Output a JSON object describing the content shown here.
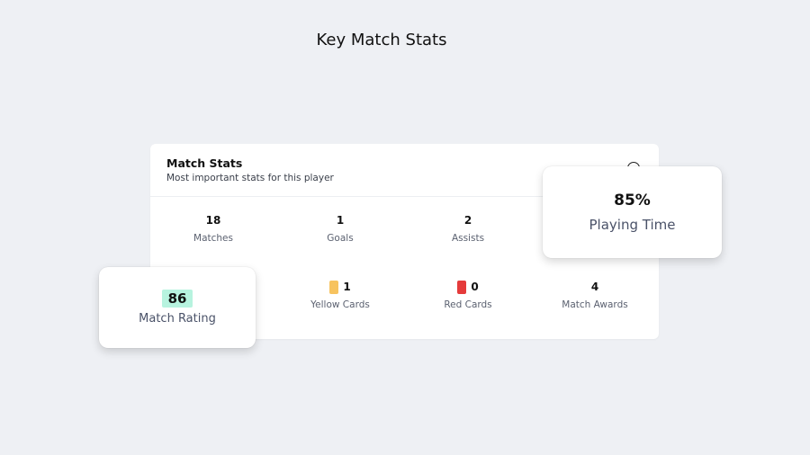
{
  "page": {
    "title": "Key Match Stats"
  },
  "card": {
    "title": "Match Stats",
    "subtitle": "Most important stats for this player"
  },
  "stats": {
    "matches": {
      "value": "18",
      "label": "Matches"
    },
    "goals": {
      "value": "1",
      "label": "Goals"
    },
    "assists": {
      "value": "2",
      "label": "Assists"
    },
    "yellow_cards": {
      "value": "1",
      "label": "Yellow Cards",
      "color": "#f7c35f"
    },
    "red_cards": {
      "value": "0",
      "label": "Red Cards",
      "color": "#e53b3b"
    },
    "match_awards": {
      "value": "4",
      "label": "Match Awards"
    }
  },
  "playing_time": {
    "value": "85%",
    "label": "Playing Time"
  },
  "match_rating": {
    "value": "86",
    "label": "Match Rating",
    "badge_color": "#b7f3df"
  },
  "icons": {
    "info": "info-circle-icon"
  }
}
